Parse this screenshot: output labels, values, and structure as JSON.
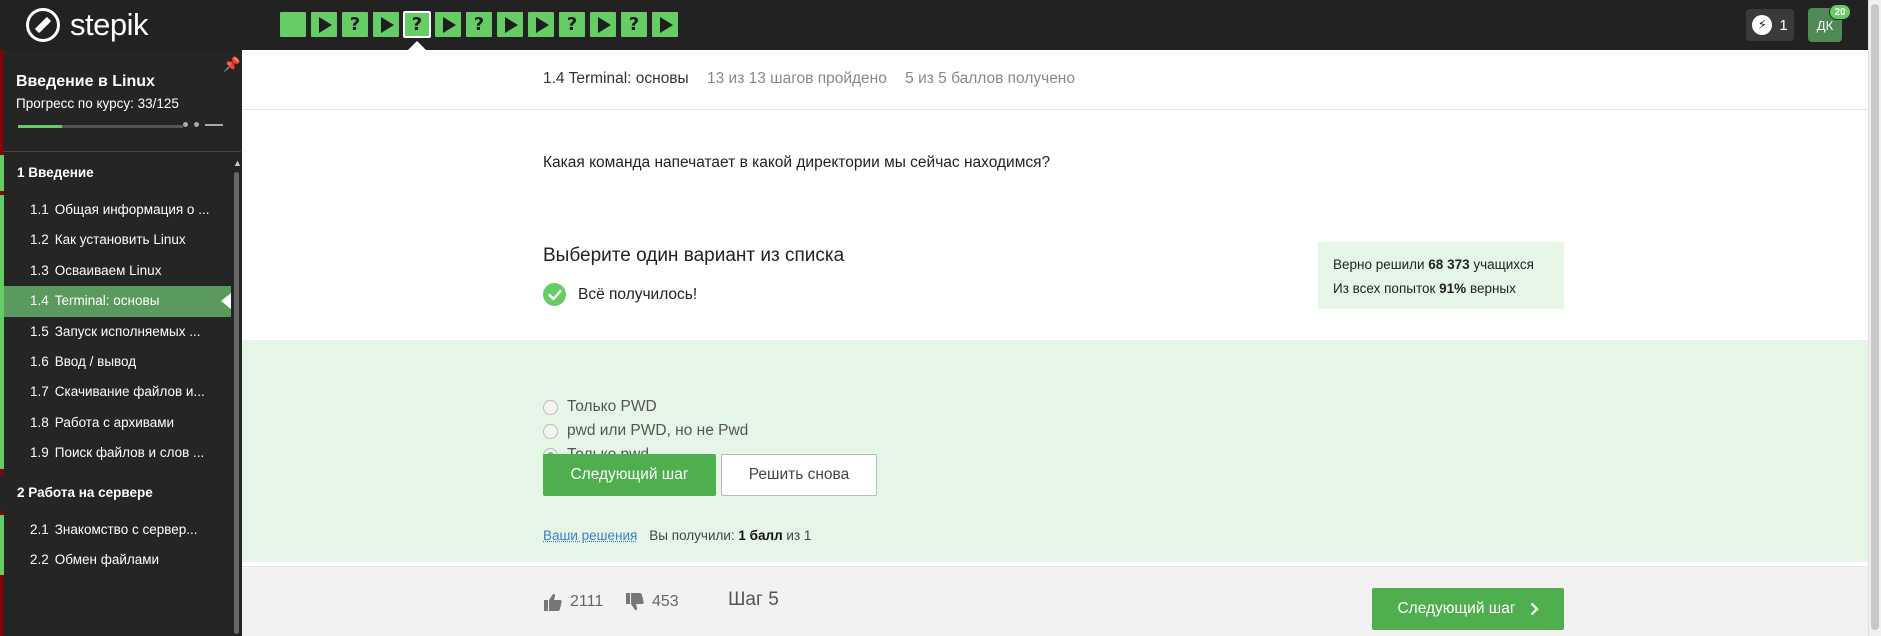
{
  "brand": {
    "name": "stepik"
  },
  "topbar": {
    "steps": [
      {
        "kind": "blank"
      },
      {
        "kind": "play"
      },
      {
        "kind": "question"
      },
      {
        "kind": "play"
      },
      {
        "kind": "question",
        "active": true
      },
      {
        "kind": "play"
      },
      {
        "kind": "question"
      },
      {
        "kind": "play"
      },
      {
        "kind": "play"
      },
      {
        "kind": "question"
      },
      {
        "kind": "play"
      },
      {
        "kind": "question"
      },
      {
        "kind": "play"
      }
    ],
    "energy_count": "1",
    "energy_icon": "lightning-icon",
    "avatar_initials": "ДК",
    "avatar_badge": "20"
  },
  "sidebar": {
    "course_title": "Введение в Linux",
    "progress_label": "Прогресс по курсу:  33/125",
    "progress_fraction": 0.264,
    "sections": [
      {
        "title": "1  Введение",
        "lessons": [
          {
            "num": "1.1",
            "label": "Общая информация о ..."
          },
          {
            "num": "1.2",
            "label": "Как установить Linux"
          },
          {
            "num": "1.3",
            "label": "Осваиваем Linux"
          },
          {
            "num": "1.4",
            "label": "Terminal: основы",
            "active": true
          },
          {
            "num": "1.5",
            "label": "Запуск исполняемых ..."
          },
          {
            "num": "1.6",
            "label": "Ввод / вывод"
          },
          {
            "num": "1.7",
            "label": "Скачивание файлов и..."
          },
          {
            "num": "1.8",
            "label": "Работа с архивами"
          },
          {
            "num": "1.9",
            "label": "Поиск файлов и слов ..."
          }
        ]
      },
      {
        "title": "2  Работа на сервере",
        "lessons": [
          {
            "num": "2.1",
            "label": "Знакомство с сервер..."
          },
          {
            "num": "2.2",
            "label": "Обмен файлами"
          }
        ]
      }
    ]
  },
  "lesson_header": {
    "title": "1.4 Terminal: основы",
    "steps_passed": "13 из 13 шагов пройдено",
    "points": "5 из 5 баллов  получено"
  },
  "question": {
    "text": "Какая команда напечатает в какой директории мы сейчас находимся?",
    "choose_label": "Выберите один вариант из списка",
    "success_text": "Всё получилось!",
    "stats": {
      "solved_prefix": "Верно решили ",
      "solved_count": "68 373",
      "solved_suffix": " учащихся",
      "attempts_prefix": "Из всех попыток ",
      "attempts_percent": "91%",
      "attempts_suffix": " верных"
    },
    "options": [
      {
        "label": "Только PWD",
        "selected": false
      },
      {
        "label": "pwd или PWD, но не Pwd",
        "selected": false
      },
      {
        "label": "Только pwd",
        "selected": true
      }
    ],
    "next_button": "Следующий шаг",
    "retry_button": "Решить снова",
    "your_solutions_link": "Ваши решения",
    "score_prefix": "Вы получили: ",
    "score_value": "1 балл",
    "score_suffix": " из 1"
  },
  "footer": {
    "likes": "2111",
    "dislikes": "453",
    "step_label": "Шаг 5",
    "next_button": "Следующий шаг"
  }
}
